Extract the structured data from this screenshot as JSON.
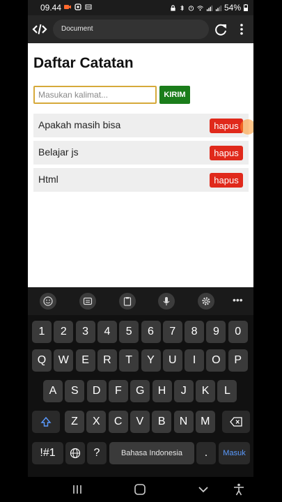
{
  "status_bar": {
    "time": "09.44",
    "battery": "54%"
  },
  "browser": {
    "tab_title": "Document"
  },
  "page": {
    "title": "Daftar Catatan",
    "input_placeholder": "Masukan kalimat...",
    "submit_label": "KIRIM",
    "notes": [
      {
        "text": "Apakah masih bisa",
        "delete_label": "hapus"
      },
      {
        "text": "Belajar js",
        "delete_label": "hapus"
      },
      {
        "text": "Html",
        "delete_label": "hapus"
      }
    ]
  },
  "keyboard": {
    "number_row": [
      "1",
      "2",
      "3",
      "4",
      "5",
      "6",
      "7",
      "8",
      "9",
      "0"
    ],
    "row1": [
      "Q",
      "W",
      "E",
      "R",
      "T",
      "Y",
      "U",
      "I",
      "O",
      "P"
    ],
    "row2": [
      "A",
      "S",
      "D",
      "F",
      "G",
      "H",
      "J",
      "K",
      "L"
    ],
    "row3": [
      "Z",
      "X",
      "C",
      "V",
      "B",
      "N",
      "M"
    ],
    "symbols_label": "!#1",
    "comma": "?",
    "space_label": "Bahasa Indonesia",
    "period": ".",
    "enter_label": "Masuk",
    "more_label": "•••"
  },
  "colors": {
    "submit_bg": "#1b7d1b",
    "delete_bg": "#e0291b",
    "input_border": "#d6a93a",
    "enter_text": "#5b9bff"
  }
}
